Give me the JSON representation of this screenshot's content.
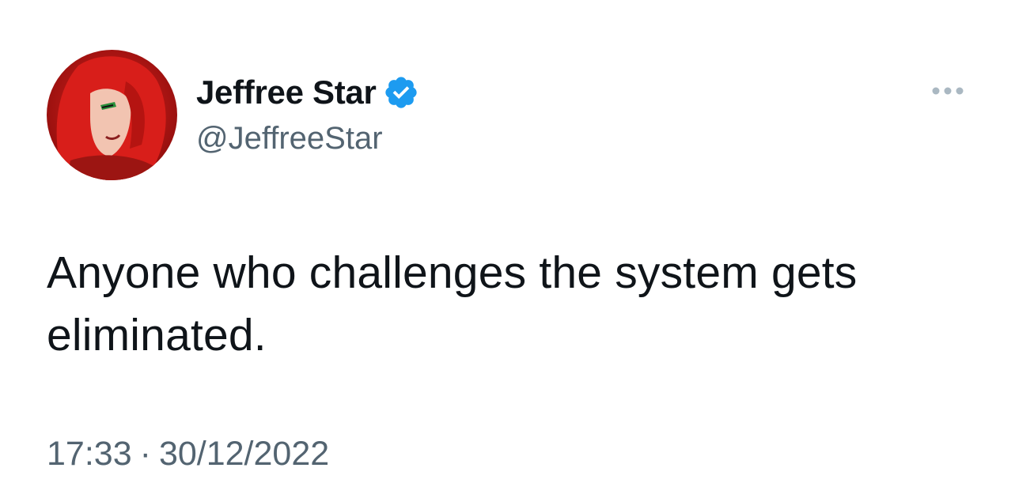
{
  "tweet": {
    "author": {
      "display_name": "Jeffree Star",
      "handle": "@JeffreeStar",
      "verified": true,
      "verified_icon": "verified-badge-icon",
      "verified_color": "#1d9bf0",
      "avatar_icon": "profile-photo-avatar"
    },
    "text": "Anyone who challenges the system gets eliminated.",
    "time": "17:33",
    "separator": "·",
    "date": "30/12/2022",
    "more_icon": "more-options-icon",
    "colors": {
      "primary_text": "#0f1419",
      "secondary_text": "#536471",
      "more_icon": "#aab8c2"
    }
  }
}
